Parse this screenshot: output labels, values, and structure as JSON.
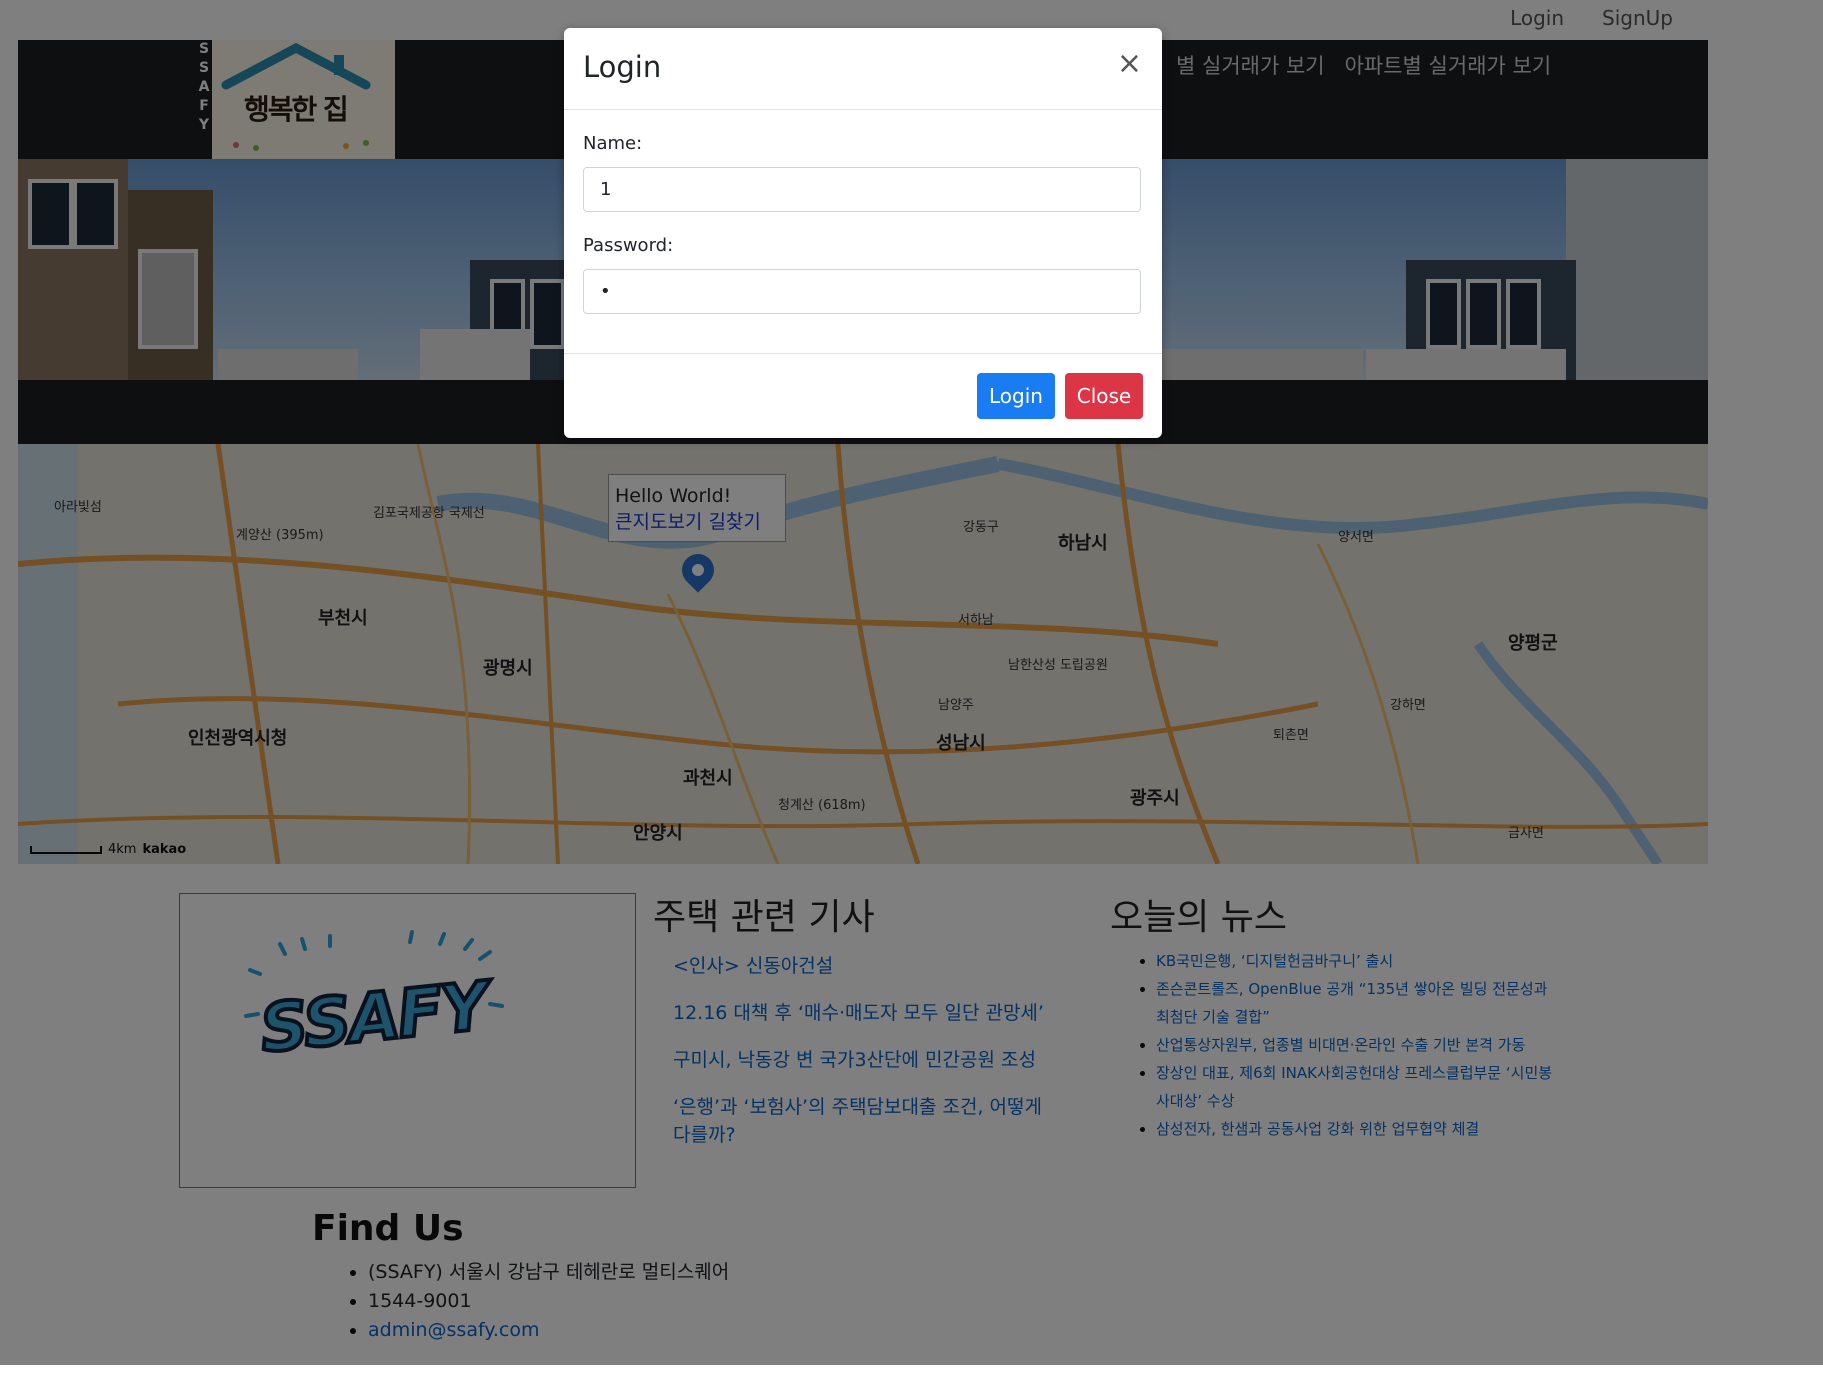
{
  "top_links": {
    "login": "Login",
    "signup": "SignUp"
  },
  "header": {
    "logo_side": "SSAFY",
    "logo_text": "행복한 집",
    "nav": [
      "별 실거래가 보기",
      "아파트별 실거래가 보기"
    ]
  },
  "map": {
    "info_title": "Hello World!",
    "info_link": "큰지도보기 길찾기",
    "scale_label": "4km",
    "attribution": "kakao",
    "places": {
      "big": [
        "인천광역시청",
        "부천시",
        "광명시",
        "과천시",
        "안양시",
        "성남시",
        "하남시",
        "광주시",
        "양평군"
      ],
      "small": [
        "아라빛섬",
        "계양산 (395m)",
        "김포국제공항 국제선",
        "강동구",
        "양서면",
        "서하남",
        "남한산성 도립공원",
        "청계산 (618m)",
        "남양주",
        "금사면",
        "퇴촌면",
        "강하면"
      ]
    }
  },
  "articles": {
    "title": "주택 관련 기사",
    "items": [
      "<인사> 신동아건설",
      "12.16 대책 후 ‘매수·매도자 모두 일단 관망세’",
      "구미시, 낙동강 변 국가3산단에 민간공원 조성",
      "‘은행’과 ‘보험사’의 주택담보대출 조건, 어떻게 다를까?"
    ]
  },
  "news": {
    "title": "오늘의 뉴스",
    "items": [
      "KB국민은행, ‘디지털헌금바구니’ 출시",
      "존슨콘트롤즈, OpenBlue 공개 “135년 쌓아온 빌딩 전문성과 최첨단 기술 결합”",
      "산업통상자원부, 업종별 비대면·온라인 수출 기반 본격 가동",
      "장상인 대표, 제6회 INAK사회공헌대상 프레스클럽부문 ‘시민봉사대상’ 수상",
      "삼성전자, 한샘과 공동사업 강화 위한 업무협약 체결"
    ]
  },
  "ssafy_card": {
    "logo_text": "SSAFY"
  },
  "findus": {
    "title": "Find Us",
    "address": "(SSAFY) 서울시 강남구 테헤란로 멀티스퀘어",
    "phone": "1544-9001",
    "email": "admin@ssafy.com"
  },
  "modal": {
    "title": "Login",
    "close_icon": "×",
    "name_label": "Name:",
    "name_value": "1",
    "password_label": "Password:",
    "password_value": "•",
    "login_button": "Login",
    "close_button": "Close",
    "colors": {
      "login": "#1a7cf3",
      "close": "#dc3545"
    }
  }
}
